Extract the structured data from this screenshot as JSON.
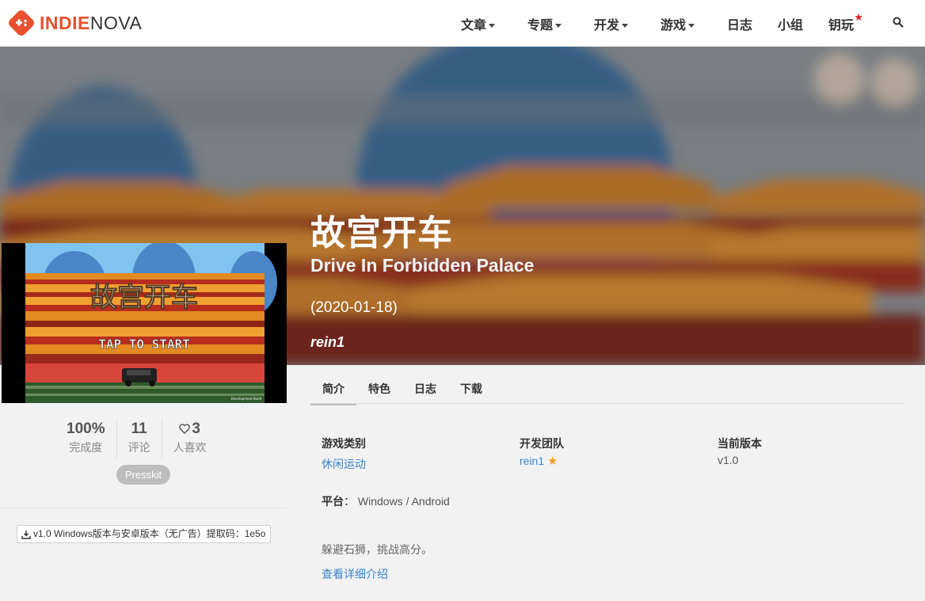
{
  "brand": {
    "part1": "INDIE",
    "part2": "NOVA",
    "accent": "#e8502e"
  },
  "nav": {
    "articles": "文章",
    "topics": "专题",
    "dev": "开发",
    "games": "游戏",
    "logs": "日志",
    "groups": "小组",
    "keyplay": "钥玩",
    "search_icon": "search-icon"
  },
  "game": {
    "title_cn": "故宫开车",
    "title_en": "Drive In Forbidden Palace",
    "date": "(2020-01-18)",
    "author": "rein1"
  },
  "cover": {
    "title_text": "故宫开车",
    "tap_text": "TAP TO START",
    "build_text": "Development Build"
  },
  "stats": {
    "completion": {
      "value": "100%",
      "label": "完成度"
    },
    "comments": {
      "value": "11",
      "label": "评论"
    },
    "likes": {
      "value": "3",
      "label": "人喜欢"
    }
  },
  "presskit": "Presskit",
  "download": "v1.0 Windows版本与安卓版本（无广告）提取码：1e5o",
  "tabs": [
    "简介",
    "特色",
    "日志",
    "下载"
  ],
  "info": {
    "genre_label": "游戏类别",
    "genre_value": "休闲运动",
    "team_label": "开发团队",
    "team_value": "rein1",
    "version_label": "当前版本",
    "version_value": "v1.0",
    "platform_label": "平台",
    "platform_value": "Windows / Android"
  },
  "description": "躲避石狮，挑战高分。",
  "more_link": "查看详细介绍"
}
